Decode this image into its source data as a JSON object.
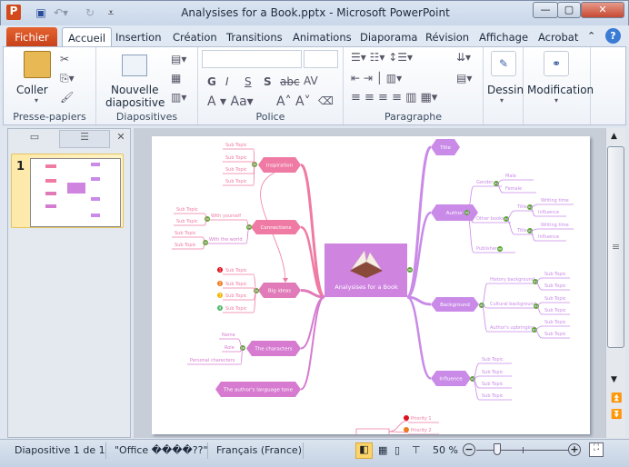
{
  "window": {
    "title": "Analysises for a Book.pptx - Microsoft PowerPoint"
  },
  "tabs": {
    "file": "Fichier",
    "items": [
      "Accueil",
      "Insertion",
      "Création",
      "Transitions",
      "Animations",
      "Diaporama",
      "Révision",
      "Affichage",
      "Acrobat"
    ]
  },
  "ribbon": {
    "paste": "Coller",
    "new_slide_1": "Nouvelle",
    "new_slide_2": "diapositive",
    "drawing": "Dessin",
    "editing": "Modification",
    "groups": [
      "Presse-papiers",
      "Diapositives",
      "Police",
      "Paragraphe"
    ],
    "font_buttons": [
      "G",
      "I",
      "S",
      "S",
      "abc",
      "AV"
    ]
  },
  "thumbnail": {
    "number": "1"
  },
  "mindmap": {
    "central": "Analysises for a Book",
    "left": {
      "inspiration": {
        "label": "Inspiration",
        "subs": [
          "Sub Topic",
          "Sub Topic",
          "Sub Topic",
          "Sub Topic"
        ]
      },
      "connections": {
        "label": "Connections",
        "with_yourself": "With yourself",
        "with_the_world": "With the world",
        "subs": [
          "Sub Topic",
          "Sub Topic",
          "Sub Topic",
          "Sub Topic"
        ]
      },
      "big_ideas": {
        "label": "Big ideas",
        "subs": [
          "Sub Topic",
          "Sub Topic",
          "Sub Topic",
          "Sub Topic"
        ],
        "priorities": [
          "1",
          "2",
          "3",
          "4"
        ]
      },
      "characters": {
        "label": "The characters",
        "subs": [
          "Name",
          "Role",
          "Personal charecters"
        ]
      },
      "language": {
        "label": "The author's  language   tone"
      }
    },
    "right": {
      "title": {
        "label": "Title"
      },
      "author": {
        "label": "Author",
        "gender": "Gender",
        "male": "Male",
        "female": "Female",
        "other_books": "Other books",
        "book_titles": [
          "Title",
          "Title"
        ],
        "book_subs": [
          "Writing time",
          "Influence",
          "Writing time",
          "Influence"
        ],
        "publisher": "Publisher"
      },
      "background": {
        "label": "Background",
        "items": [
          "History background",
          "Cultural background",
          "Author's upbringing"
        ],
        "subs": [
          "Sub Topic",
          "Sub Topic",
          "Sub Topic",
          "Sub Topic",
          "Sub Topic",
          "Sub Topic"
        ]
      },
      "influence": {
        "label": "Influence",
        "subs": [
          "Sub Topic",
          "Sub Topic",
          "Sub Topic",
          "Sub Topic"
        ]
      }
    },
    "bottom": {
      "priorities": [
        "Priority 1",
        "Priority 2"
      ]
    },
    "colors": {
      "pink": "#ef7aa3",
      "purple": "#c98ae8",
      "central": "#cf84e0",
      "green": "#5aa632"
    }
  },
  "status": {
    "slide": "Diapositive 1 de 1",
    "theme": "\"Office ����??\"",
    "language": "Français (France)",
    "zoom": "50 %",
    "zoom_percent": 50
  }
}
